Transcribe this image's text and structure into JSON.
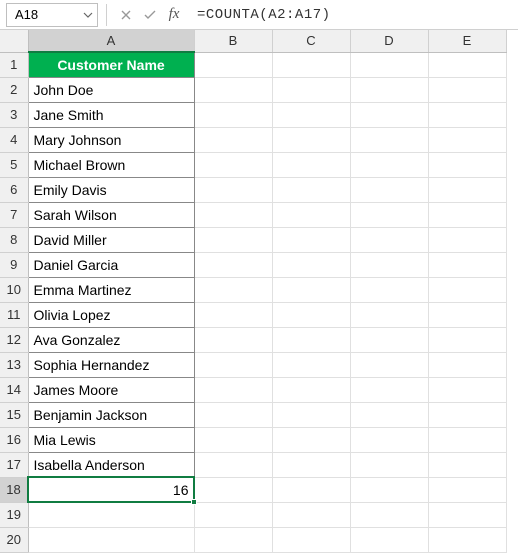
{
  "formula_bar": {
    "name_box": "A18",
    "formula": "=COUNTA(A2:A17)"
  },
  "columns": [
    "A",
    "B",
    "C",
    "D",
    "E"
  ],
  "row_count": 20,
  "header": {
    "A1": "Customer Name"
  },
  "data": {
    "A2": "John Doe",
    "A3": "Jane Smith",
    "A4": "Mary Johnson",
    "A5": "Michael Brown",
    "A6": "Emily Davis",
    "A7": "Sarah Wilson",
    "A8": "David Miller",
    "A9": "Daniel Garcia",
    "A10": "Emma Martinez",
    "A11": "Olivia Lopez",
    "A12": "Ava Gonzalez",
    "A13": "Sophia Hernandez",
    "A14": "James Moore",
    "A15": "Benjamin Jackson",
    "A16": "Mia Lewis",
    "A17": "Isabella Anderson",
    "A18": "16"
  },
  "selected_cell": "A18"
}
